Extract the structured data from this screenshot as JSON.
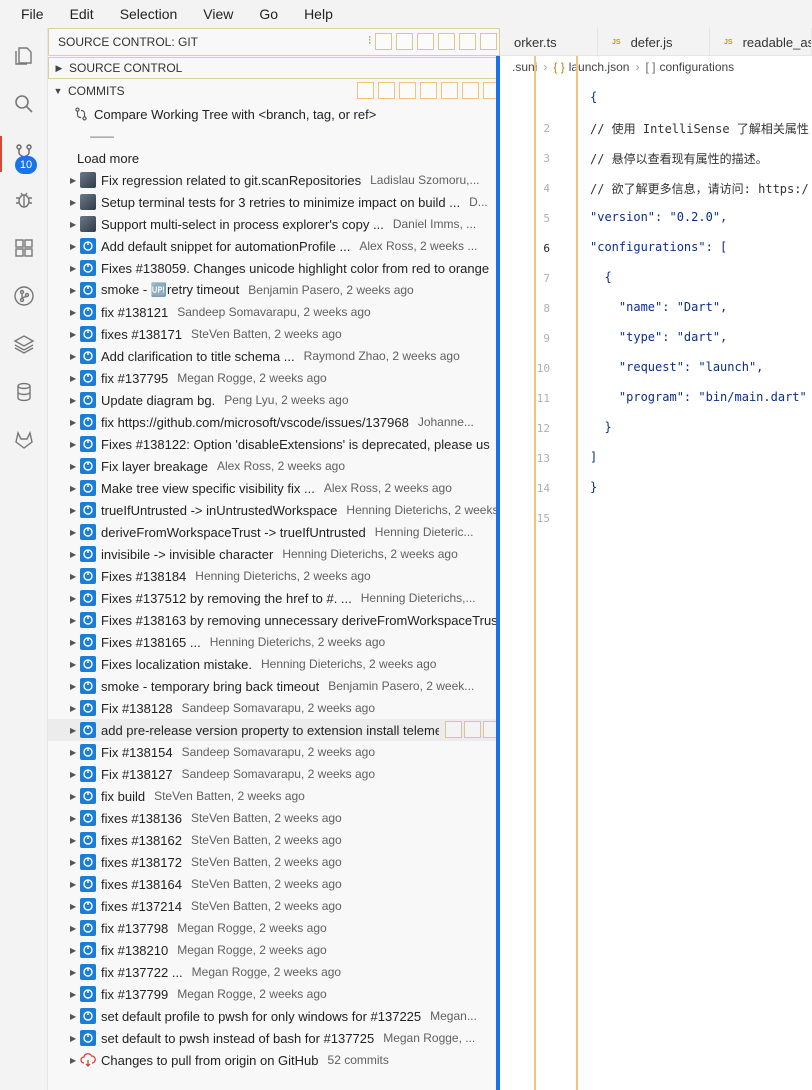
{
  "menu": [
    "File",
    "Edit",
    "Selection",
    "View",
    "Go",
    "Help"
  ],
  "activity": {
    "scm_badge": "10"
  },
  "panel": {
    "title": "SOURCE CONTROL: GIT",
    "source_control_label": "SOURCE CONTROL",
    "commits_label": "COMMITS",
    "compare_label": "Compare Working Tree with <branch, tag, or ref>",
    "separator": "——",
    "load_more": "Load more",
    "footer_msg": "Changes to pull from origin on GitHub",
    "footer_count": "52 commits"
  },
  "commits": [
    {
      "msg": "Fix regression related to git.scanRepositories",
      "author": "Ladislau Szomoru,...",
      "avatar": "photo"
    },
    {
      "msg": "Setup terminal tests for 3 retries to minimize impact on build ...",
      "author": "D...",
      "avatar": "photo"
    },
    {
      "msg": "Support multi-select in process explorer's copy ...",
      "author": "Daniel Imms, ...",
      "avatar": "photo"
    },
    {
      "msg": "Add default snippet for automationProfile ...",
      "author": "Alex Ross, 2 weeks ...",
      "avatar": "commit"
    },
    {
      "msg": "Fixes #138059. Changes unicode highlight color from red to orange",
      "author": "",
      "avatar": "commit"
    },
    {
      "msg": "smoke - 🆙retry timeout",
      "author": "Benjamin Pasero, 2 weeks ago",
      "avatar": "commit"
    },
    {
      "msg": "fix #138121",
      "author": "Sandeep Somavarapu, 2 weeks ago",
      "avatar": "commit"
    },
    {
      "msg": "fixes #138171",
      "author": "SteVen Batten, 2 weeks ago",
      "avatar": "commit"
    },
    {
      "msg": "Add clarification to title schema ...",
      "author": "Raymond Zhao, 2 weeks ago",
      "avatar": "commit"
    },
    {
      "msg": "fix #137795",
      "author": "Megan Rogge, 2 weeks ago",
      "avatar": "commit"
    },
    {
      "msg": "Update diagram bg.",
      "author": "Peng Lyu, 2 weeks ago",
      "avatar": "commit"
    },
    {
      "msg": "fix https://github.com/microsoft/vscode/issues/137968",
      "author": "Johanne...",
      "avatar": "commit"
    },
    {
      "msg": "Fixes #138122: Option 'disableExtensions' is deprecated, please us",
      "author": "",
      "avatar": "commit"
    },
    {
      "msg": "Fix layer breakage",
      "author": "Alex Ross, 2 weeks ago",
      "avatar": "commit"
    },
    {
      "msg": "Make tree view specific visibility fix ...",
      "author": "Alex Ross, 2 weeks ago",
      "avatar": "commit"
    },
    {
      "msg": "trueIfUntrusted -> inUntrustedWorkspace",
      "author": "Henning Dieterichs, 2 weeks ago",
      "avatar": "commit"
    },
    {
      "msg": "deriveFromWorkspaceTrust -> trueIfUntrusted",
      "author": "Henning Dieteric...",
      "avatar": "commit"
    },
    {
      "msg": "invisibile -> invisible character",
      "author": "Henning Dieterichs, 2 weeks ago",
      "avatar": "commit"
    },
    {
      "msg": "Fixes #138184",
      "author": "Henning Dieterichs, 2 weeks ago",
      "avatar": "commit"
    },
    {
      "msg": "Fixes #137512 by removing the href to #. ...",
      "author": "Henning Dieterichs,...",
      "avatar": "commit"
    },
    {
      "msg": "Fixes #138163 by removing unnecessary deriveFromWorkspaceTrus",
      "author": "",
      "avatar": "commit"
    },
    {
      "msg": "Fixes #138165 ...",
      "author": "Henning Dieterichs, 2 weeks ago",
      "avatar": "commit"
    },
    {
      "msg": "Fixes localization mistake.",
      "author": "Henning Dieterichs, 2 weeks ago",
      "avatar": "commit"
    },
    {
      "msg": "smoke - temporary bring back timeout",
      "author": "Benjamin Pasero, 2 week...",
      "avatar": "commit"
    },
    {
      "msg": "Fix #138128",
      "author": "Sandeep Somavarapu, 2 weeks ago",
      "avatar": "commit"
    },
    {
      "msg": "add pre-release version property to extension install teleme",
      "author": "",
      "avatar": "commit",
      "hover": true
    },
    {
      "msg": "Fix #138154",
      "author": "Sandeep Somavarapu, 2 weeks ago",
      "avatar": "commit"
    },
    {
      "msg": "Fix #138127",
      "author": "Sandeep Somavarapu, 2 weeks ago",
      "avatar": "commit"
    },
    {
      "msg": "fix build",
      "author": "SteVen Batten, 2 weeks ago",
      "avatar": "commit"
    },
    {
      "msg": "fixes #138136",
      "author": "SteVen Batten, 2 weeks ago",
      "avatar": "commit"
    },
    {
      "msg": "fixes #138162",
      "author": "SteVen Batten, 2 weeks ago",
      "avatar": "commit"
    },
    {
      "msg": "fixes #138172",
      "author": "SteVen Batten, 2 weeks ago",
      "avatar": "commit"
    },
    {
      "msg": "fixes #138164",
      "author": "SteVen Batten, 2 weeks ago",
      "avatar": "commit"
    },
    {
      "msg": "fixes #137214",
      "author": "SteVen Batten, 2 weeks ago",
      "avatar": "commit"
    },
    {
      "msg": "fix #137798",
      "author": "Megan Rogge, 2 weeks ago",
      "avatar": "commit"
    },
    {
      "msg": "fix #138210",
      "author": "Megan Rogge, 2 weeks ago",
      "avatar": "commit"
    },
    {
      "msg": "fix #137722 ...",
      "author": "Megan Rogge, 2 weeks ago",
      "avatar": "commit"
    },
    {
      "msg": "fix #137799",
      "author": "Megan Rogge, 2 weeks ago",
      "avatar": "commit"
    },
    {
      "msg": "set default profile to pwsh for only windows for #137225",
      "author": "Megan...",
      "avatar": "commit"
    },
    {
      "msg": "set default to pwsh instead of bash for #137725",
      "author": "Megan Rogge, ...",
      "avatar": "commit"
    }
  ],
  "editor": {
    "tabs": [
      {
        "label": "orker.ts",
        "kind": "ts"
      },
      {
        "label": "defer.js",
        "kind": "js"
      },
      {
        "label": "readable_as",
        "kind": "js"
      }
    ],
    "crumbs": [
      ".suni",
      "launch.json",
      "configurations"
    ],
    "lines": [
      {
        "n": "",
        "text": "{"
      },
      {
        "n": "2",
        "text": "// 使用 IntelliSense 了解相关属性"
      },
      {
        "n": "3",
        "text": "// 悬停以查看现有属性的描述。"
      },
      {
        "n": "4",
        "text": "// 欲了解更多信息，请访问: https:/"
      },
      {
        "n": "5",
        "text": "\"version\": \"0.2.0\","
      },
      {
        "n": "6",
        "text": "\"configurations\": ["
      },
      {
        "n": "7",
        "text": "  {"
      },
      {
        "n": "8",
        "text": "    \"name\": \"Dart\","
      },
      {
        "n": "9",
        "text": "    \"type\": \"dart\","
      },
      {
        "n": "10",
        "text": "    \"request\": \"launch\","
      },
      {
        "n": "11",
        "text": "    \"program\": \"bin/main.dart\""
      },
      {
        "n": "12",
        "text": "  }"
      },
      {
        "n": "13",
        "text": "]"
      },
      {
        "n": "14",
        "text": "}"
      },
      {
        "n": "15",
        "text": ""
      }
    ]
  }
}
